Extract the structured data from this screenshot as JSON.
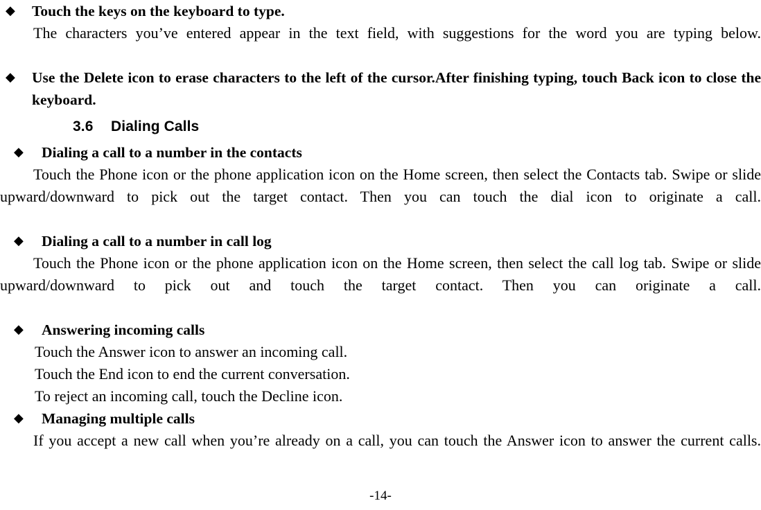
{
  "document": {
    "page_number": "-14-",
    "bullet_glyph": "◆"
  },
  "blocks": {
    "b1_bullet": "Touch the keys on the keyboard to type.",
    "b1_para": "The characters you’ve entered appear in the text field, with suggestions for the word you are typing below.",
    "b2_bullet": "Use the Delete icon to erase characters to the left of the cursor.After finishing typing, touch Back icon to close the keyboard."
  },
  "section": {
    "number": "3.6",
    "title": "Dialing Calls",
    "items": [
      {
        "heading": "Dialing a call to a number in the contacts",
        "paragraph": "Touch the Phone icon or the phone application icon on the Home screen, then select the Contacts tab. Swipe or slide upward/downward to pick out the target contact. Then you can touch the dial icon to originate a call."
      },
      {
        "heading": "Dialing a call to a number in call log",
        "paragraph": "Touch the Phone icon or the phone application icon on the Home screen, then select the call log tab. Swipe or slide upward/downward to pick out and touch the target contact. Then you can originate a call."
      },
      {
        "heading": "Answering incoming calls",
        "lines": [
          "Touch the Answer icon to answer an incoming call.",
          "Touch the End icon to end the current conversation.",
          "To reject an incoming call, touch the Decline icon."
        ]
      },
      {
        "heading": "Managing multiple calls",
        "paragraph": "If you accept a new call when you’re already on a call, you can touch the Answer icon to answer the current calls."
      }
    ]
  }
}
